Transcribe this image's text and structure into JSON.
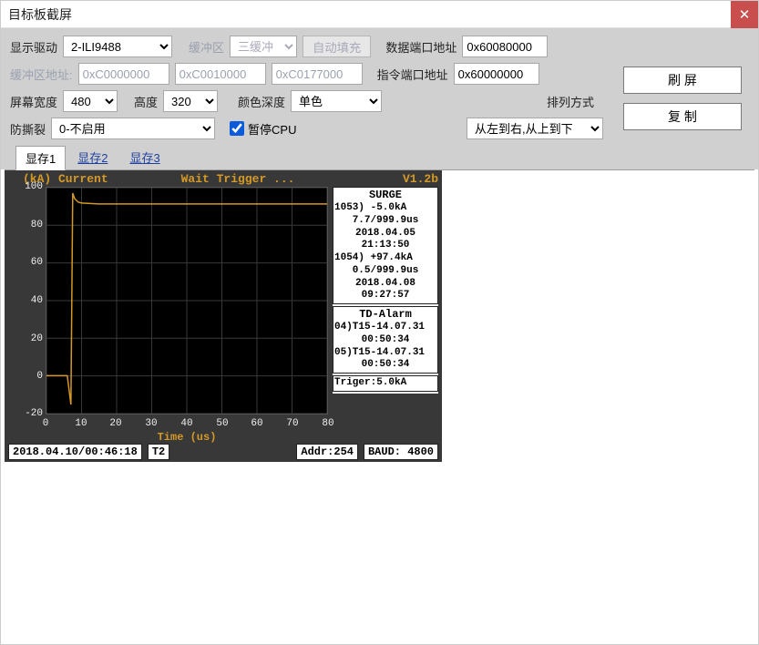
{
  "window": {
    "title": "目标板截屏"
  },
  "labels": {
    "display_driver": "显示驱动",
    "buffer": "缓冲区",
    "auto_fill": "自动填充",
    "data_port_addr": "数据端口地址",
    "buffer_addr": "缓冲区地址:",
    "cmd_port_addr": "指令端口地址",
    "screen_width": "屏幕宽度",
    "height": "高度",
    "color_depth": "颜色深度",
    "arrangement": "排列方式",
    "anti_tear": "防撕裂",
    "pause_cpu": "暂停CPU",
    "refresh": "刷 屏",
    "copy": "复 制"
  },
  "values": {
    "display_driver": "2-ILI9488",
    "buffer": "三缓冲",
    "data_port_addr": "0x60080000",
    "buf0": "0xC0000000",
    "buf1": "0xC0010000",
    "buf2": "0xC0177000",
    "cmd_port_addr": "0x60000000",
    "width": "480",
    "height": "320",
    "color_depth": "单色",
    "arrangement": "从左到右,从上到下",
    "anti_tear": "0-不启用"
  },
  "tabs": [
    "显存1",
    "显存2",
    "显存3"
  ],
  "screen": {
    "header": {
      "left": "(kA)  Current",
      "mid": "Wait  Trigger  ...",
      "ver": "V1.2b"
    },
    "xlabel": "Time  (us)",
    "surge": {
      "title": "SURGE",
      "r1": "1053) -5.0kA",
      "r2": "7.7/999.9us",
      "r3": "2018.04.05",
      "r4": "21:13:50",
      "r5": "1054) +97.4kA",
      "r6": "0.5/999.9us",
      "r7": "2018.04.08",
      "r8": "09:27:57"
    },
    "tdalarm": {
      "title": "TD-Alarm",
      "r1": "04)T15-14.07.31",
      "r2": "00:50:34",
      "r3": "05)T15-14.07.31",
      "r4": "00:50:34"
    },
    "trigger": "Triger:5.0kA",
    "bottom": {
      "datetime": "2018.04.10/00:46:18",
      "tz": "T2",
      "addr": "Addr:254",
      "baud": "BAUD: 4800"
    }
  },
  "chart_data": {
    "type": "line",
    "title": "(kA) Current  Wait Trigger ...",
    "xlabel": "Time (us)",
    "ylabel": "kA",
    "xlim": [
      0,
      80
    ],
    "ylim": [
      -20,
      100
    ],
    "xticks": [
      0,
      10,
      20,
      30,
      40,
      50,
      60,
      70,
      80
    ],
    "yticks": [
      -20,
      0,
      20,
      40,
      60,
      80,
      100
    ],
    "series": [
      {
        "name": "Current",
        "x": [
          0,
          6,
          7,
          7.5,
          8,
          9,
          10,
          15,
          20,
          30,
          40,
          50,
          60,
          70,
          80
        ],
        "y": [
          0,
          0,
          -15,
          97,
          94,
          92,
          92,
          91,
          91,
          91,
          91,
          91,
          91,
          91,
          91
        ]
      }
    ]
  }
}
